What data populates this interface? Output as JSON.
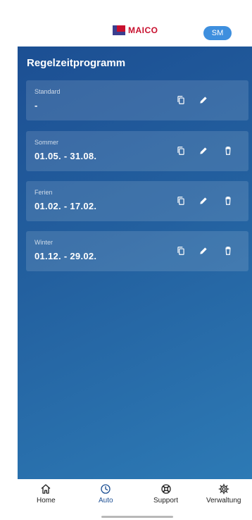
{
  "header": {
    "brand": "MAICO",
    "avatar_initials": "SM"
  },
  "page": {
    "title": "Regelzeitprogramm"
  },
  "programs": [
    {
      "name": "Standard",
      "range": "-",
      "has_delete": false
    },
    {
      "name": "Sommer",
      "range": "01.05. - 31.08.",
      "has_delete": true
    },
    {
      "name": "Ferien",
      "range": "01.02. - 17.02.",
      "has_delete": true
    },
    {
      "name": "Winter",
      "range": "01.12. - 29.02.",
      "has_delete": true
    }
  ],
  "nav": {
    "items": [
      {
        "label": "Home",
        "icon": "home-icon"
      },
      {
        "label": "Auto",
        "icon": "clock-icon",
        "active": true
      },
      {
        "label": "Support",
        "icon": "lifebuoy-icon"
      },
      {
        "label": "Verwaltung",
        "icon": "gear-icon"
      }
    ]
  },
  "colors": {
    "accent": "#3e8fde",
    "brand_red": "#c8102e",
    "background_top": "#1c4f93",
    "background_bottom": "#2d7ab5"
  }
}
